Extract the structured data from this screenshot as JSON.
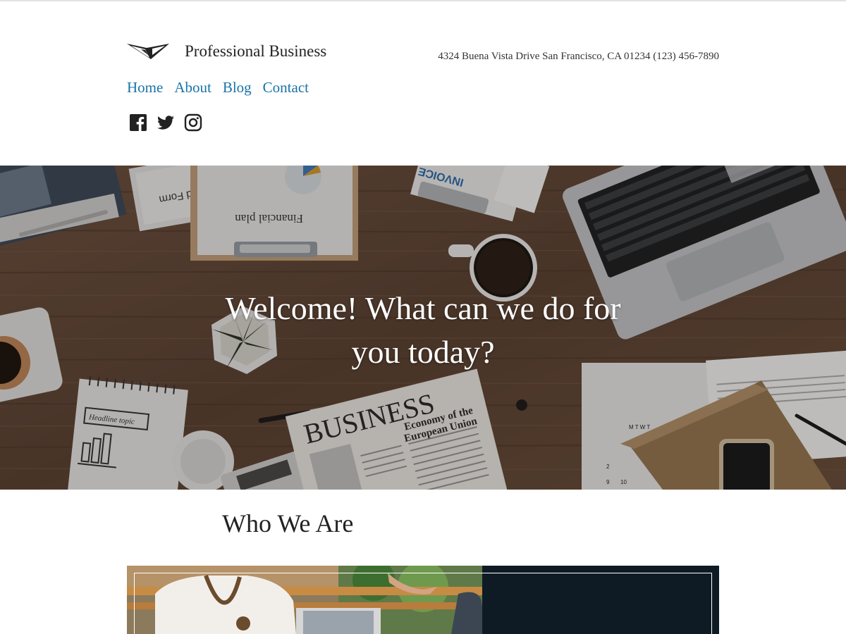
{
  "site": {
    "title": "Professional Business",
    "address": "4324 Buena Vista Drive San Francisco, CA 01234 (123) 456-7890"
  },
  "nav": {
    "items": [
      {
        "label": "Home"
      },
      {
        "label": "About"
      },
      {
        "label": "Blog"
      },
      {
        "label": "Contact"
      }
    ]
  },
  "social": {
    "icons": [
      "facebook-icon",
      "twitter-icon",
      "instagram-icon"
    ]
  },
  "hero": {
    "title": "Welcome! What can we do for you today?",
    "photo_text": {
      "tax_form": "Tax Refund Form",
      "financial_plan": "Financial plan",
      "invoice": "INVOICE",
      "newspaper_masthead": "BUSINESS",
      "newspaper_headline_1": "Economy of the",
      "newspaper_headline_2": "European Union",
      "notebook_heading": "Headline topic"
    }
  },
  "section": {
    "title": "Who We Are"
  },
  "colors": {
    "link": "#1a73a8",
    "dark_panel": "#0e1b24",
    "wood": "#6b4f3a"
  }
}
